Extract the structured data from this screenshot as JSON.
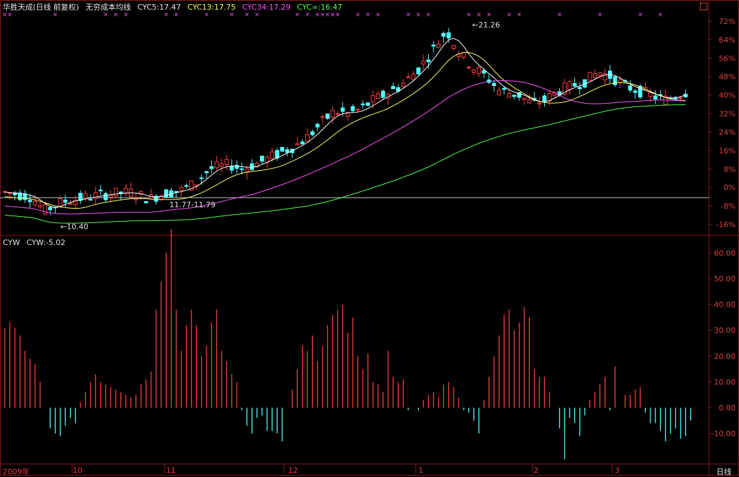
{
  "upper_header": {
    "stock": "华胜天成(日线 前复权)",
    "indicator": "无穷成本均线",
    "cyc5": "CYC5:17.47",
    "cyc13": "CYC13:17.75",
    "cyc34": "CYC34:17.29",
    "cycinf": "CYC∞:16.47"
  },
  "lower_header": {
    "name": "CYW",
    "value": "CYW:-5.02"
  },
  "annotations": {
    "high": "21.26",
    "low": "10.40",
    "range": "11.77-11.79"
  },
  "colors": {
    "up": "#ff4040",
    "down": "#54ffff",
    "grid": "#8b1a1a",
    "cyc5": "#ffffff",
    "cyc13": "#ffff66",
    "cyc34": "#ff55ff",
    "cycinf": "#55ff55"
  },
  "chart_data": [
    {
      "type": "candlestick",
      "title": "华胜天成(日线 前复权)",
      "y_axis_labels": [
        "72%",
        "64%",
        "56%",
        "48%",
        "40%",
        "32%",
        "24%",
        "16%",
        "8%",
        "0%",
        "-8%",
        "-16%"
      ],
      "ylim": [
        -16,
        72
      ],
      "grid": true,
      "series": [
        {
          "name": "CYC5",
          "value": 17.47
        },
        {
          "name": "CYC13",
          "value": 17.75
        },
        {
          "name": "CYC34",
          "value": 17.29
        },
        {
          "name": "CYC∞",
          "value": 16.47
        }
      ]
    },
    {
      "type": "bar",
      "title": "CYW",
      "y_axis_labels": [
        "60.00",
        "50.00",
        "40.00",
        "30.00",
        "20.00",
        "10.00",
        "0.00",
        "-10.00"
      ],
      "ylim": [
        -20,
        65
      ],
      "values": [
        31,
        33,
        31,
        28,
        22,
        19,
        17,
        10,
        0,
        -8,
        -10,
        -11,
        -7,
        -4,
        -6,
        2,
        6,
        10,
        13,
        10,
        9,
        8,
        7,
        6,
        5,
        4,
        5,
        9,
        11,
        14,
        38,
        49,
        60,
        69,
        38,
        22,
        32,
        38,
        32,
        20,
        24,
        33,
        38,
        22,
        18,
        13,
        10,
        -1,
        -7,
        -10,
        -4,
        -3,
        -9,
        -9,
        -10,
        -13,
        0,
        7,
        15,
        24,
        22,
        28,
        18,
        24,
        32,
        36,
        38,
        40,
        29,
        35,
        20,
        15,
        21,
        10,
        9,
        6,
        22,
        12,
        10,
        11,
        -1,
        0,
        -1,
        3,
        5,
        6,
        4,
        9,
        10,
        8,
        4,
        -1,
        -2,
        -5,
        -10,
        3,
        12,
        20,
        28,
        36,
        38,
        30,
        33,
        39,
        35,
        15,
        12,
        12,
        6,
        0,
        -8,
        -20,
        -4,
        -6,
        -11,
        -3,
        3,
        6,
        9,
        12,
        -1,
        16,
        0,
        5,
        5,
        7,
        8,
        -2,
        -6,
        -6,
        -9,
        -13,
        -10,
        -8,
        -12,
        -11,
        -5
      ]
    }
  ],
  "x_axis": {
    "labels": [
      "2009年",
      "10",
      "11",
      "12",
      "1",
      "2",
      "3"
    ],
    "cycle": "日线"
  }
}
